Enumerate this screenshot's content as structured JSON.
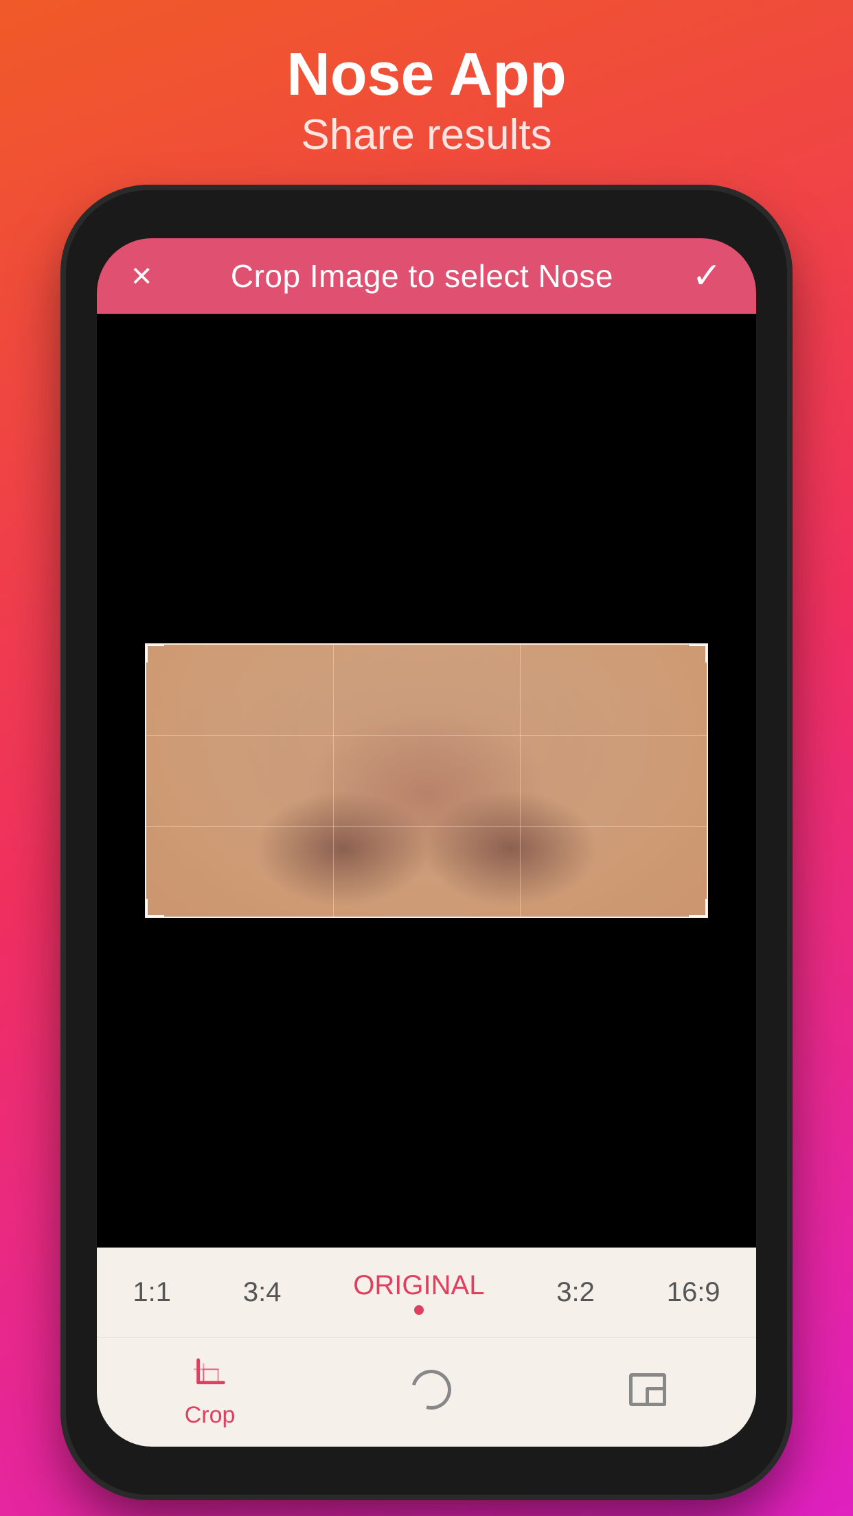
{
  "header": {
    "title": "Nose App",
    "subtitle": "Share results"
  },
  "topbar": {
    "close_label": "×",
    "title": "Crop Image to select Nose",
    "confirm_label": "✓"
  },
  "ratios": [
    {
      "label": "1:1",
      "active": false
    },
    {
      "label": "3:4",
      "active": false
    },
    {
      "label": "ORIGINAL",
      "active": true
    },
    {
      "label": "3:2",
      "active": false
    },
    {
      "label": "16:9",
      "active": false
    }
  ],
  "toolbar": {
    "crop_label": "Crop",
    "reset_label": "",
    "aspect_label": ""
  }
}
